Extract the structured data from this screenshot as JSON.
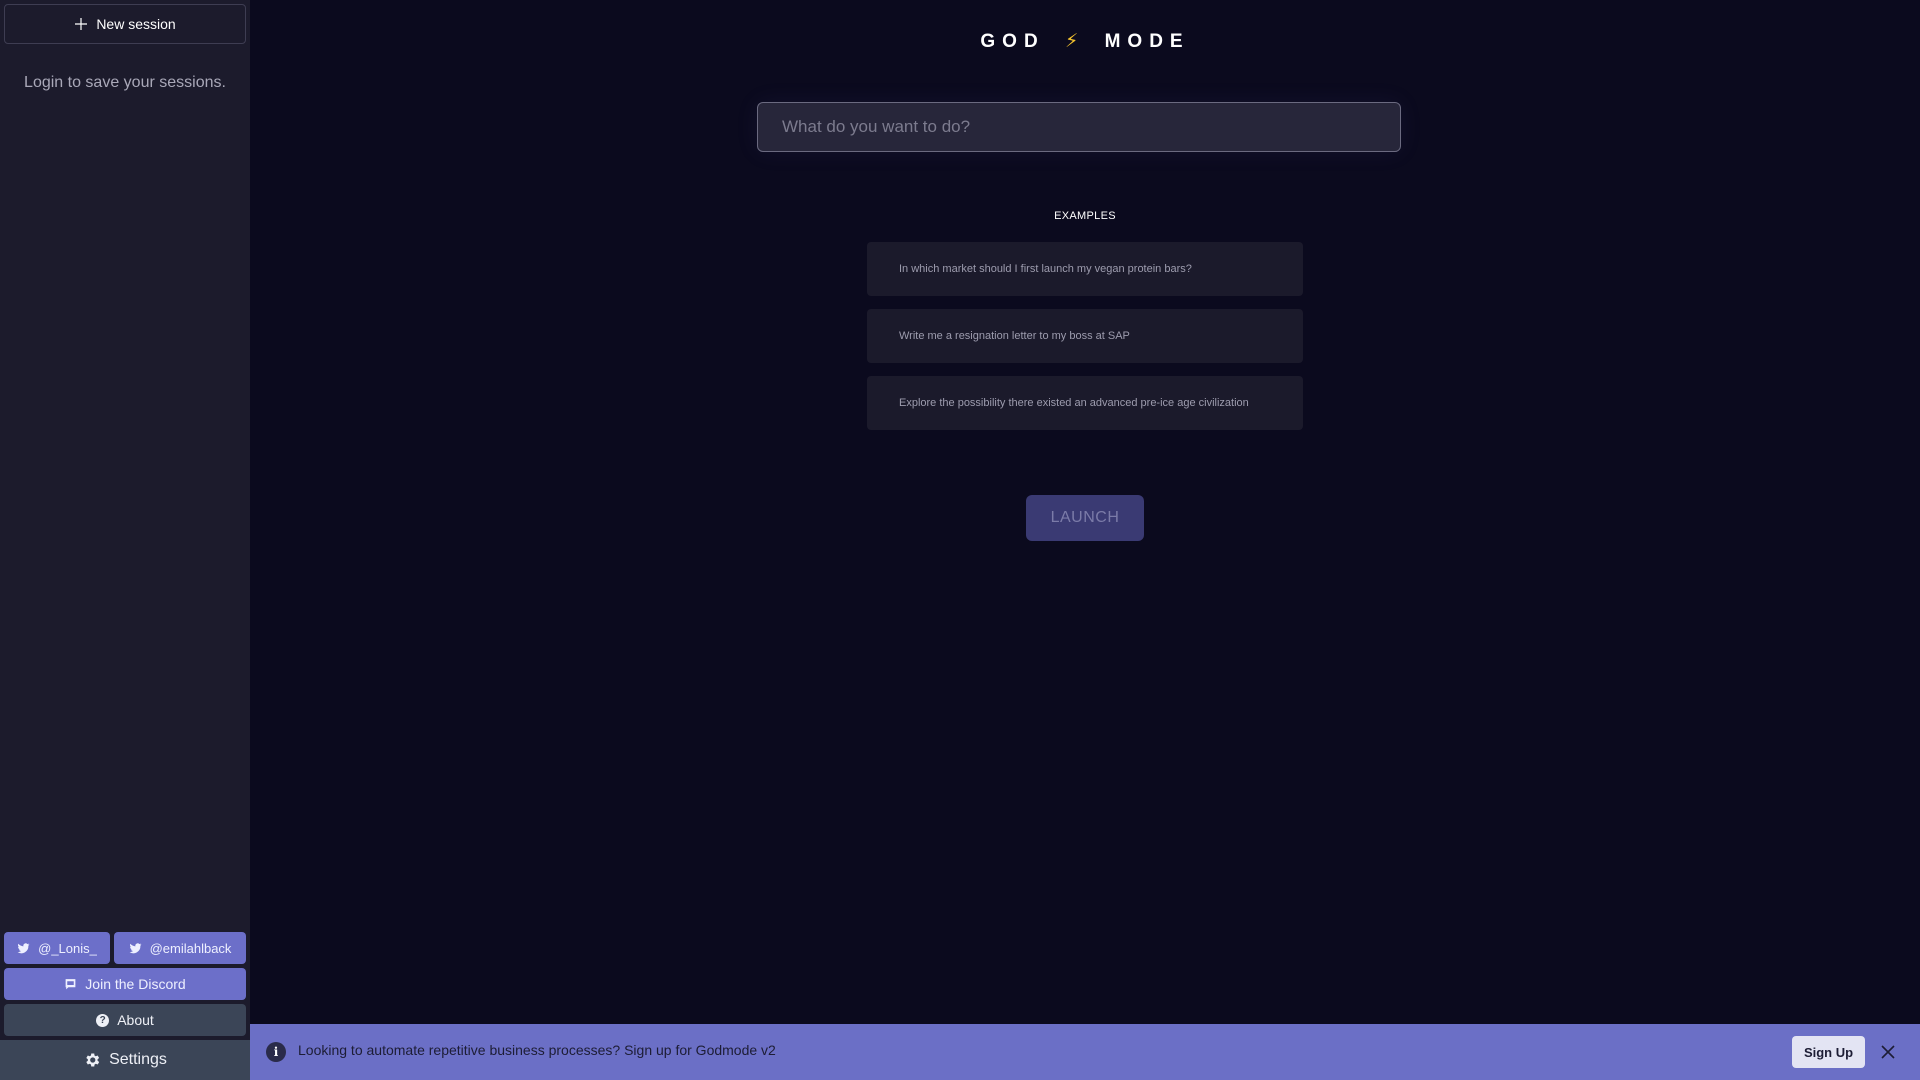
{
  "sidebar": {
    "new_session_label": "New session",
    "login_note": "Login to save your sessions.",
    "twitter_1": "@_Lonis_",
    "twitter_2": "@emilahlback",
    "discord_label": "Join the Discord",
    "about_label": "About",
    "settings_label": "Settings"
  },
  "header": {
    "logo_left": "GOD",
    "logo_bolt": "⚡",
    "logo_right": "MODE"
  },
  "search": {
    "placeholder": "What do you want to do?",
    "value": ""
  },
  "examples": {
    "title": "EXAMPLES",
    "items": [
      "In which market should I first launch my vegan protein bars?",
      "Write me a resignation letter to my boss at SAP",
      "Explore the possibility there existed an advanced pre-ice age civilization"
    ]
  },
  "launch_label": "LAUNCH",
  "banner": {
    "info_icon": "i",
    "text": "Looking to automate repetitive business processes? Sign up for Godmode v2",
    "signup_label": "Sign Up"
  },
  "colors": {
    "background": "#0b0a1e",
    "sidebar": "#1c1b2c",
    "accent": "#6b6fc6",
    "bolt": "#f2c12e"
  },
  "icons": [
    "plus-icon",
    "twitter-icon",
    "discord-icon",
    "question-icon",
    "gear-icon",
    "info-icon",
    "close-icon"
  ]
}
